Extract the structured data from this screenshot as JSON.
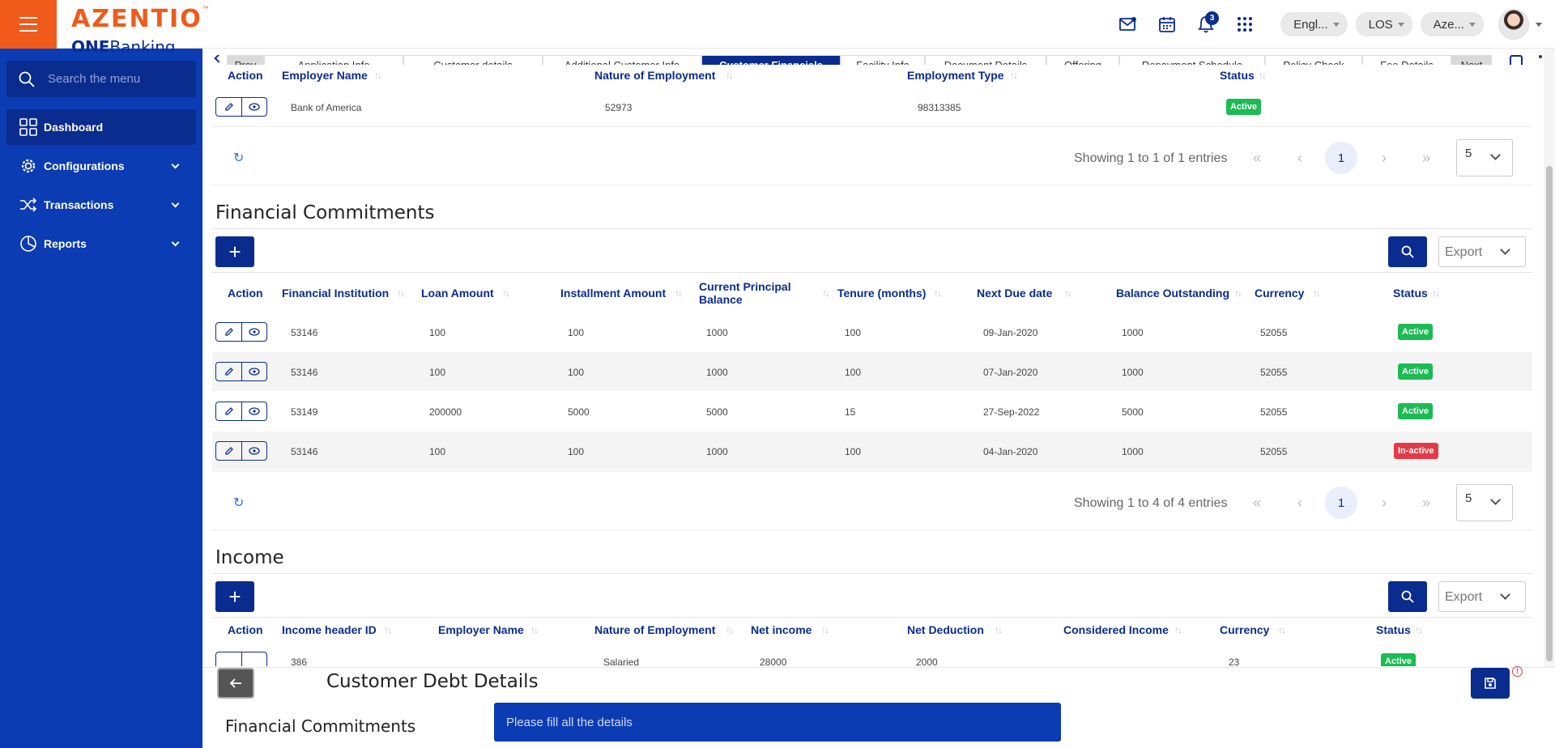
{
  "header": {
    "brand": "AZENTIO",
    "trademark": "™",
    "product_bold": "ONE",
    "product_light": "Banking",
    "notification_count": "3",
    "language": "Engl...",
    "module": "LOS",
    "tenant": "Aze..."
  },
  "sidebar": {
    "search_placeholder": "Search the menu",
    "items": [
      {
        "label": "Dashboard",
        "icon": "dashboard-icon"
      },
      {
        "label": "Configurations",
        "icon": "gear-icon"
      },
      {
        "label": "Transactions",
        "icon": "shuffle-icon"
      },
      {
        "label": "Reports",
        "icon": "pie-chart-icon"
      }
    ]
  },
  "stepper": {
    "prev": "Prev",
    "steps": [
      "Application Info",
      "Customer details",
      "Additional Customer Info",
      "Customer Financials",
      "Facility Info",
      "Document Details",
      "Offering",
      "Repayment Schedule",
      "Policy Check",
      "Fee Details"
    ],
    "current": "Customer Financials",
    "next": "Next"
  },
  "employment": {
    "headers": [
      "Action",
      "Employer Name",
      "Nature of Employment",
      "Employment Type",
      "Status"
    ],
    "rows": [
      {
        "employer": "Bank of America",
        "nature": "52973",
        "type": "98313385",
        "status": "Active"
      }
    ],
    "showing": "Showing 1 to 1 of 1 entries",
    "page": "1",
    "page_size": "5"
  },
  "financial_commitments": {
    "title": "Financial Commitments",
    "export_label": "Export",
    "headers": [
      "Action",
      "Financial Institution",
      "Loan Amount",
      "Installment Amount",
      "Current Principal Balance",
      "Tenure (months)",
      "Next Due date",
      "Balance Outstanding",
      "Currency",
      "Status"
    ],
    "rows": [
      {
        "institution": "53146",
        "loan": "100",
        "installment": "100",
        "principal": "1000",
        "tenure": "100",
        "due": "09-Jan-2020",
        "balance": "1000",
        "currency": "52055",
        "status": "Active"
      },
      {
        "institution": "53146",
        "loan": "100",
        "installment": "100",
        "principal": "1000",
        "tenure": "100",
        "due": "07-Jan-2020",
        "balance": "1000",
        "currency": "52055",
        "status": "Active"
      },
      {
        "institution": "53149",
        "loan": "200000",
        "installment": "5000",
        "principal": "5000",
        "tenure": "15",
        "due": "27-Sep-2022",
        "balance": "5000",
        "currency": "52055",
        "status": "Active"
      },
      {
        "institution": "53146",
        "loan": "100",
        "installment": "100",
        "principal": "1000",
        "tenure": "100",
        "due": "04-Jan-2020",
        "balance": "1000",
        "currency": "52055",
        "status": "In-active"
      }
    ],
    "showing": "Showing 1 to 4 of 4 entries",
    "page": "1",
    "page_size": "5"
  },
  "income": {
    "title": "Income",
    "export_label": "Export",
    "headers": [
      "Action",
      "Income header ID",
      "Employer Name",
      "Nature of Employment",
      "Net income",
      "Net Deduction",
      "Considered Income",
      "Currency",
      "Status"
    ],
    "rows": [
      {
        "id": "386",
        "employer": "",
        "nature": "Salaried",
        "net_income": "28000",
        "net_deduction": "2000",
        "considered": "",
        "currency": "23",
        "status": "Active"
      }
    ]
  },
  "bottom_panel": {
    "title": "Customer Debt Details",
    "subtitle": "Financial Commitments",
    "warn_glyph": "!"
  },
  "toast": {
    "message": "Please fill all the details"
  },
  "colors": {
    "brand_orange": "#f05a1a",
    "primary_blue": "#0a2c8f",
    "sidebar_blue": "#0b3cb3",
    "active_green": "#1cbb54",
    "inactive_red": "#e53945"
  }
}
